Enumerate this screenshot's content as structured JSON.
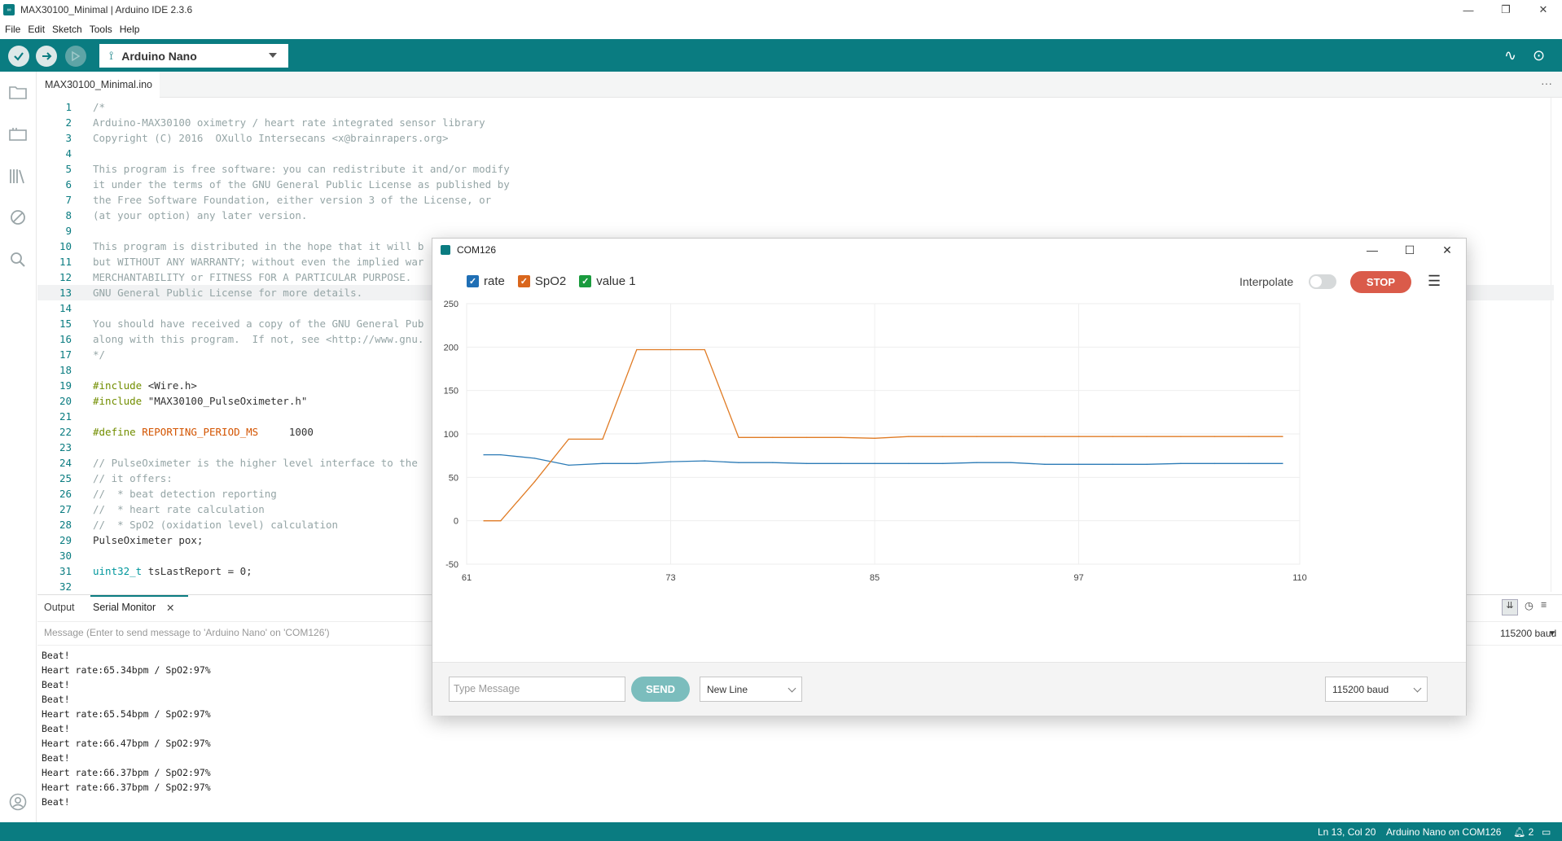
{
  "window": {
    "title": "MAX30100_Minimal | Arduino IDE 2.3.6",
    "app_icon_text": "∞",
    "controls": [
      "—",
      "❐",
      "✕"
    ]
  },
  "menu": [
    "File",
    "Edit",
    "Sketch",
    "Tools",
    "Help"
  ],
  "toolbar": {
    "board": "Arduino Nano",
    "verify_icon": "check-icon",
    "upload_icon": "arrow-right-icon",
    "debug_icon": "debug-icon",
    "plotter_icon": "∿",
    "monitor_icon": "⊙"
  },
  "file_tab": {
    "name": "MAX30100_Minimal.ino",
    "more": "···"
  },
  "code": [
    {
      "n": "1",
      "parts": [
        [
          "c",
          "/*"
        ]
      ]
    },
    {
      "n": "2",
      "parts": [
        [
          "c",
          "Arduino-MAX30100 oximetry / heart rate integrated sensor library"
        ]
      ]
    },
    {
      "n": "3",
      "parts": [
        [
          "c",
          "Copyright (C) 2016  OXullo Intersecans <x@brainrapers.org>"
        ]
      ]
    },
    {
      "n": "4",
      "parts": [
        [
          "c",
          ""
        ]
      ]
    },
    {
      "n": "5",
      "parts": [
        [
          "c",
          "This program is free software: you can redistribute it and/or modify"
        ]
      ]
    },
    {
      "n": "6",
      "parts": [
        [
          "c",
          "it under the terms of the GNU General Public License as published by"
        ]
      ]
    },
    {
      "n": "7",
      "parts": [
        [
          "c",
          "the Free Software Foundation, either version 3 of the License, or"
        ]
      ]
    },
    {
      "n": "8",
      "parts": [
        [
          "c",
          "(at your option) any later version."
        ]
      ]
    },
    {
      "n": "9",
      "parts": [
        [
          "c",
          ""
        ]
      ]
    },
    {
      "n": "10",
      "parts": [
        [
          "c",
          "This program is distributed in the hope that it will b"
        ]
      ]
    },
    {
      "n": "11",
      "parts": [
        [
          "c",
          "but WITHOUT ANY WARRANTY; without even the implied war"
        ]
      ]
    },
    {
      "n": "12",
      "parts": [
        [
          "c",
          "MERCHANTABILITY or FITNESS FOR A PARTICULAR PURPOSE."
        ]
      ]
    },
    {
      "n": "13",
      "parts": [
        [
          "c",
          "GNU General Public License for more details."
        ]
      ]
    },
    {
      "n": "14",
      "parts": [
        [
          "c",
          ""
        ]
      ]
    },
    {
      "n": "15",
      "parts": [
        [
          "c",
          "You should have received a copy of the GNU General Pub"
        ]
      ]
    },
    {
      "n": "16",
      "parts": [
        [
          "c",
          "along with this program.  If not, see <http://www.gnu."
        ]
      ]
    },
    {
      "n": "17",
      "parts": [
        [
          "c",
          "*/"
        ]
      ]
    },
    {
      "n": "18",
      "parts": [
        [
          "c",
          ""
        ]
      ]
    },
    {
      "n": "19",
      "parts": [
        [
          "k",
          "#include "
        ],
        [
          "n",
          "<Wire.h>"
        ]
      ]
    },
    {
      "n": "20",
      "parts": [
        [
          "k",
          "#include "
        ],
        [
          "n",
          "\"MAX30100_PulseOximeter.h\""
        ]
      ]
    },
    {
      "n": "21",
      "parts": [
        [
          "c",
          ""
        ]
      ]
    },
    {
      "n": "22",
      "parts": [
        [
          "k",
          "#define "
        ],
        [
          "d",
          "REPORTING_PERIOD_MS"
        ],
        [
          "n",
          "     1000"
        ]
      ]
    },
    {
      "n": "23",
      "parts": [
        [
          "c",
          ""
        ]
      ]
    },
    {
      "n": "24",
      "parts": [
        [
          "c",
          "// PulseOximeter is the higher level interface to the"
        ]
      ]
    },
    {
      "n": "25",
      "parts": [
        [
          "c",
          "// it offers:"
        ]
      ]
    },
    {
      "n": "26",
      "parts": [
        [
          "c",
          "//  * beat detection reporting"
        ]
      ]
    },
    {
      "n": "27",
      "parts": [
        [
          "c",
          "//  * heart rate calculation"
        ]
      ]
    },
    {
      "n": "28",
      "parts": [
        [
          "c",
          "//  * SpO2 (oxidation level) calculation"
        ]
      ]
    },
    {
      "n": "29",
      "parts": [
        [
          "n",
          "PulseOximeter pox;"
        ]
      ]
    },
    {
      "n": "30",
      "parts": [
        [
          "c",
          ""
        ]
      ]
    },
    {
      "n": "31",
      "parts": [
        [
          "t",
          "uint32_t"
        ],
        [
          "n",
          " tsLastReport = 0;"
        ]
      ]
    },
    {
      "n": "32",
      "parts": [
        [
          "c",
          ""
        ]
      ]
    }
  ],
  "active_line": "13",
  "bottom": {
    "tab_output": "Output",
    "tab_serial": "Serial Monitor",
    "tab_close": "✕",
    "message_placeholder": "Message (Enter to send message to 'Arduino Nano' on 'COM126')",
    "baud": "115200 baud",
    "serial_lines": [
      "Beat!",
      "Heart rate:65.34bpm / SpO2:97%",
      "Beat!",
      "Beat!",
      "Heart rate:65.54bpm / SpO2:97%",
      "Beat!",
      "Heart rate:66.47bpm / SpO2:97%",
      "Beat!",
      "Heart rate:66.37bpm / SpO2:97%",
      "Heart rate:66.37bpm / SpO2:97%",
      "Beat!"
    ]
  },
  "status": {
    "position": "Ln 13, Col 20",
    "board_port": "Arduino Nano on COM126",
    "notifications": "2"
  },
  "plotter": {
    "title": "COM126",
    "interpolate_label": "Interpolate",
    "interpolate_on": false,
    "stop_label": "STOP",
    "send_label": "SEND",
    "message_placeholder": "Type Message",
    "line_ending": "New Line",
    "baud": "115200 baud"
  },
  "chart_data": {
    "type": "line",
    "ylim": [
      -50,
      250
    ],
    "xlim": [
      61,
      110
    ],
    "y_ticks": [
      "250",
      "200",
      "150",
      "100",
      "50",
      "0",
      "-50"
    ],
    "x_ticks": [
      "61",
      "73",
      "85",
      "97",
      "110"
    ],
    "grid": true,
    "legend_position": "top-left",
    "x": [
      62,
      63,
      65,
      67,
      69,
      71,
      73,
      75,
      77,
      79,
      81,
      83,
      85,
      87,
      89,
      91,
      93,
      95,
      97,
      99,
      101,
      103,
      105,
      107,
      109
    ],
    "series": [
      {
        "name": "rate",
        "color": "#2c7bb6",
        "checkbox_color": "#1f6fb5",
        "values": [
          76,
          76,
          72,
          64,
          66,
          66,
          68,
          69,
          67,
          67,
          66,
          66,
          66,
          66,
          66,
          67,
          67,
          65,
          65,
          65,
          65,
          66,
          66,
          66,
          66
        ]
      },
      {
        "name": "SpO2",
        "color": "#e07b24",
        "checkbox_color": "#d9661c",
        "values": [
          0,
          0,
          45,
          94,
          94,
          197,
          197,
          197,
          96,
          96,
          96,
          96,
          95,
          97,
          97,
          97,
          97,
          97,
          97,
          97,
          97,
          97,
          97,
          97,
          97
        ]
      },
      {
        "name": "value 1",
        "color": "#1a9b3e",
        "checkbox_color": "#1a9b3e",
        "values": []
      }
    ]
  }
}
